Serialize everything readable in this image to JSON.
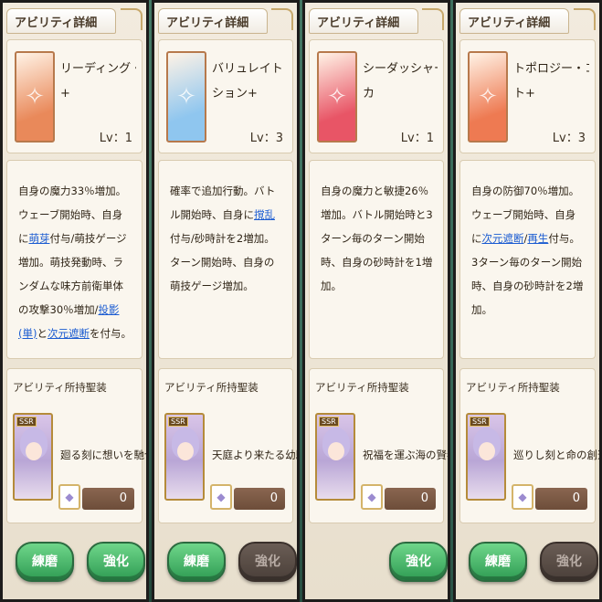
{
  "panels": [
    {
      "title": "アビリティ詳細",
      "ability_name": "リーディング・ポラリスト",
      "ability_name_line2": "+",
      "level": "Lv：1",
      "icon_color": "#e9895a",
      "desc_parts": [
        {
          "t": "自身の魔力33％増加。ウェーブ開始時、自身に"
        },
        {
          "t": "萌芽",
          "link": true
        },
        {
          "t": "付与/萌技ゲージ増加。萌技発動時、ランダムな味方前衛単体の攻撃30％増加/"
        },
        {
          "t": "投影(単)",
          "link": true
        },
        {
          "t": "と"
        },
        {
          "t": "次元遮断",
          "link": true
        },
        {
          "t": "を付与。"
        }
      ],
      "item_header": "アビリティ所持聖装",
      "card_rarity": "SSR",
      "item_name": "廻る刻に想いを馳せて",
      "count": "0",
      "buttons": [
        {
          "label": "練磨",
          "style": "green"
        },
        {
          "label": "強化",
          "style": "green"
        }
      ]
    },
    {
      "title": "アビリティ詳細",
      "ability_name": "バリュレイト・エモー",
      "ability_name_line2": "ション+",
      "level": "Lv：3",
      "icon_color": "#8fc6ef",
      "desc_parts": [
        {
          "t": "確率で追加行動。バトル開始時、自身に"
        },
        {
          "t": "撹乱",
          "link": true
        },
        {
          "t": "付与/砂時計を2増加。ターン開始時、自身の萌技ゲージ増加。"
        }
      ],
      "item_header": "アビリティ所持聖装",
      "card_rarity": "SSR",
      "item_name": "天庭より来たる幼馴染",
      "count": "0",
      "buttons": [
        {
          "label": "練磨",
          "style": "green"
        },
        {
          "label": "強化",
          "style": "gray"
        }
      ]
    },
    {
      "title": "アビリティ詳細",
      "ability_name": "シーダッシャー・イール",
      "ability_name_line2": "カ",
      "level": "Lv：1",
      "icon_color": "#e85566",
      "desc_parts": [
        {
          "t": "自身の魔力と敏捷26％増加。バトル開始時と3ターン毎のターン開始時、自身の砂時計を1増加。"
        }
      ],
      "item_header": "アビリティ所持聖装",
      "card_rarity": "SSR",
      "item_name": "祝福を運ぶ海の賢者",
      "count": "0",
      "buttons": [
        {
          "label": "強化",
          "style": "green"
        }
      ]
    },
    {
      "title": "アビリティ詳細",
      "ability_name": "トポロジー・コントラス",
      "ability_name_line2": "ト+",
      "level": "Lv：3",
      "icon_color": "#ee7a52",
      "desc_parts": [
        {
          "t": "自身の防御70％増加。ウェーブ開始時、自身に"
        },
        {
          "t": "次元遮断",
          "link": true
        },
        {
          "t": "/"
        },
        {
          "t": "再生",
          "link": true
        },
        {
          "t": "付与。3ターン毎のターン開始時、自身の砂時計を2増加。"
        }
      ],
      "item_header": "アビリティ所持聖装",
      "card_rarity": "SSR",
      "item_name": "巡りし刻と命の創造者",
      "count": "0",
      "buttons": [
        {
          "label": "練磨",
          "style": "green"
        },
        {
          "label": "強化",
          "style": "gray"
        }
      ]
    }
  ]
}
